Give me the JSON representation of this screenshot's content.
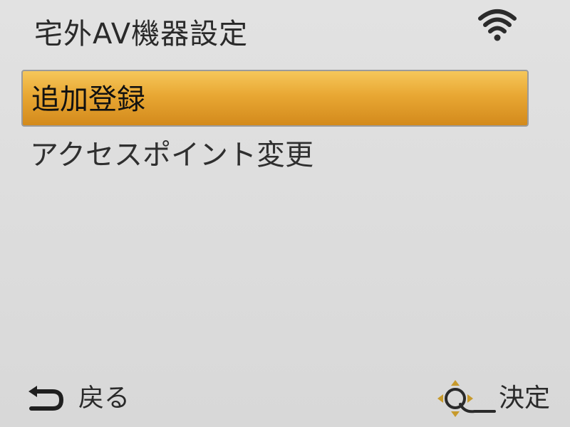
{
  "header": {
    "title": "宅外AV機器設定",
    "status_icon": "wifi-icon"
  },
  "menu": {
    "items": [
      {
        "label": "追加登録",
        "selected": true
      },
      {
        "label": "アクセスポイント変更",
        "selected": false
      }
    ]
  },
  "footer": {
    "back_label": "戻る",
    "back_icon": "return-arrow-icon",
    "confirm_label": "決定",
    "confirm_icon": "dpad-q-icon"
  },
  "colors": {
    "background": "#dcdcdc",
    "selection_top": "#f6c75a",
    "selection_bottom": "#d38a1c",
    "text": "#2a2a2a"
  }
}
